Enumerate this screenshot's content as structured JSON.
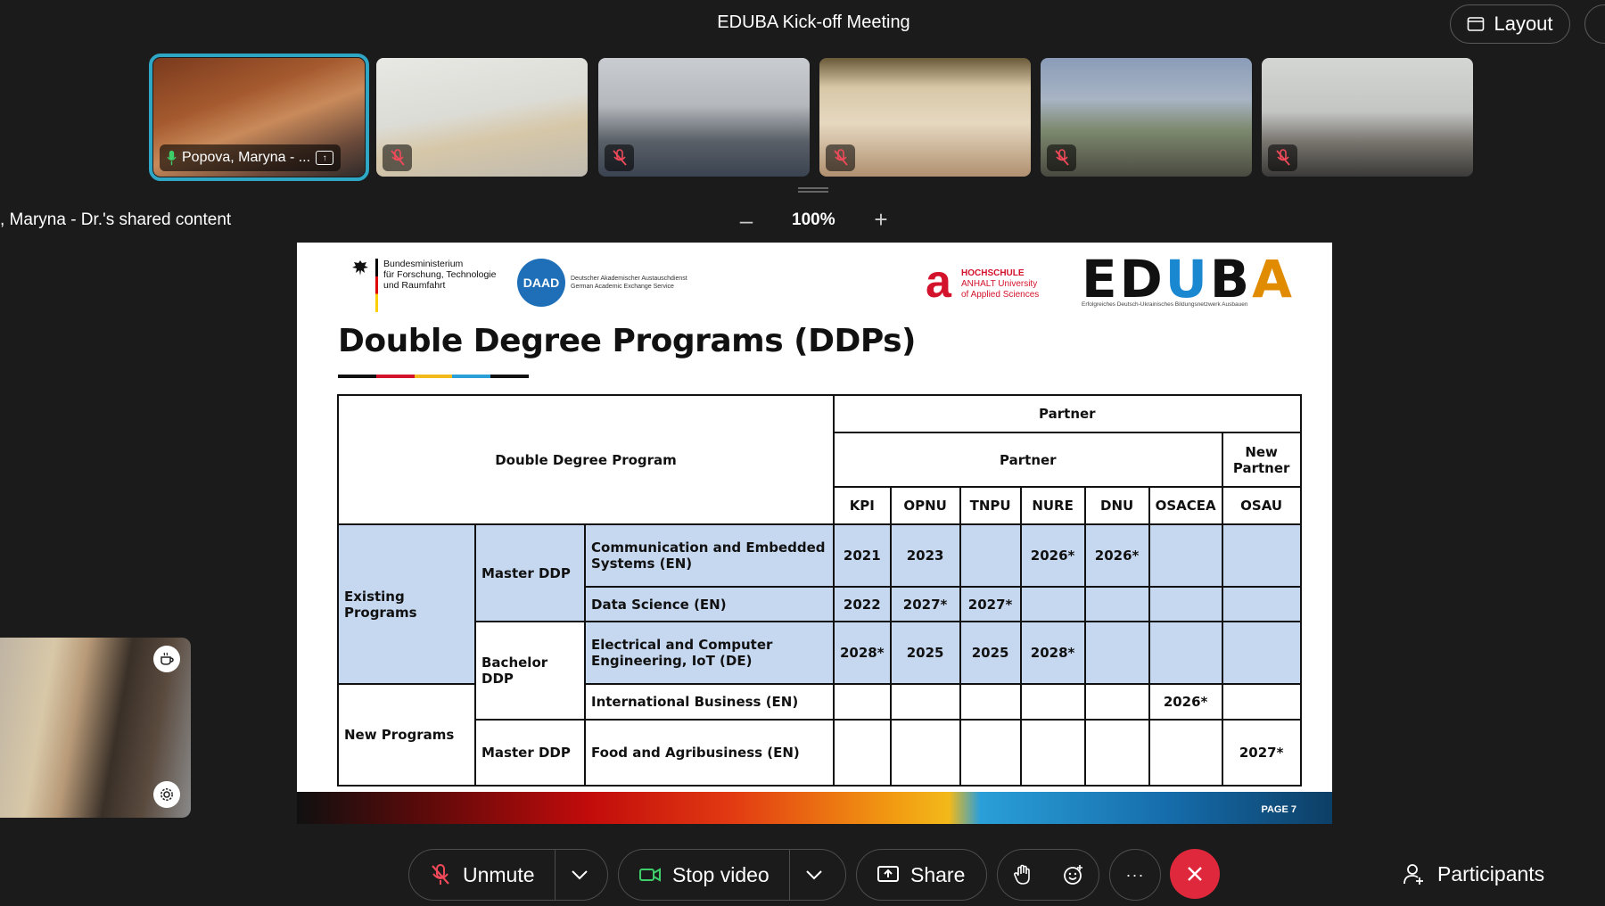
{
  "header": {
    "meeting_title": "EDUBA Kick-off Meeting",
    "layout_label": "Layout"
  },
  "thumbnails": [
    {
      "name": "Popova, Maryna - ...",
      "mic": "on",
      "active": true
    },
    {
      "name": "",
      "mic": "muted"
    },
    {
      "name": "",
      "mic": "muted"
    },
    {
      "name": "",
      "mic": "muted"
    },
    {
      "name": "",
      "mic": "muted"
    },
    {
      "name": "",
      "mic": "muted"
    }
  ],
  "shared": {
    "label": ", Maryna - Dr.'s shared content",
    "zoom": "100%",
    "zoom_out": "–",
    "zoom_in": "+"
  },
  "slide": {
    "bmf_text": [
      "Bundesministerium",
      "für Forschung, Technologie",
      "und Raumfahrt"
    ],
    "daad_logo": "DAAD",
    "daad_text": [
      "Deutscher Akademischer Austauschdienst",
      "German Academic Exchange Service"
    ],
    "hsa_text": [
      "HOCHSCHULE",
      "ANHALT University",
      "of Applied Sciences"
    ],
    "eduba_word": "EDUBA",
    "eduba_sub": "Erfolgreiches Deutsch-Ukrainisches Bildungsnetzwerk Ausbauen",
    "title": "Double Degree Programs (DDPs)",
    "page": "PAGE 7",
    "table": {
      "program_header": "Double Degree Program",
      "partner_top": "Partner",
      "partner_sub": "Partner",
      "new_partner": "New Partner",
      "partners": [
        "KPI",
        "OPNU",
        "TNPU",
        "NURE",
        "DNU",
        "OSACEA",
        "OSAU"
      ],
      "groups": {
        "existing": "Existing Programs",
        "new": "New Programs",
        "master": "Master DDP",
        "bachelor": "Bachelor DDP",
        "master2": "Master DDP"
      },
      "rows": [
        {
          "program": "Communication and Embedded Systems (EN)",
          "values": [
            "2021",
            "2023",
            "",
            "2026*",
            "2026*",
            "",
            ""
          ]
        },
        {
          "program": "Data Science (EN)",
          "values": [
            "2022",
            "2027*",
            "2027*",
            "",
            "",
            "",
            ""
          ]
        },
        {
          "program": "Electrical and Computer Engineering, IoT (DE)",
          "values": [
            "2028*",
            "2025",
            "2025",
            "2028*",
            "",
            "",
            ""
          ]
        },
        {
          "program": "International Business (EN)",
          "values": [
            "",
            "",
            "",
            "",
            "",
            "2026*",
            ""
          ]
        },
        {
          "program": "Food and Agribusiness (EN)",
          "values": [
            "",
            "",
            "",
            "",
            "",
            "",
            "2027*"
          ]
        }
      ]
    }
  },
  "toolbar": {
    "unmute": "Unmute",
    "stop_video": "Stop video",
    "share": "Share",
    "more": "···",
    "participants": "Participants"
  },
  "colors": {
    "active_outline": "#2fa6c4",
    "leave": "#e0283c",
    "table_blue": "#c6d8f0",
    "video_icon": "#3ecf6a"
  }
}
